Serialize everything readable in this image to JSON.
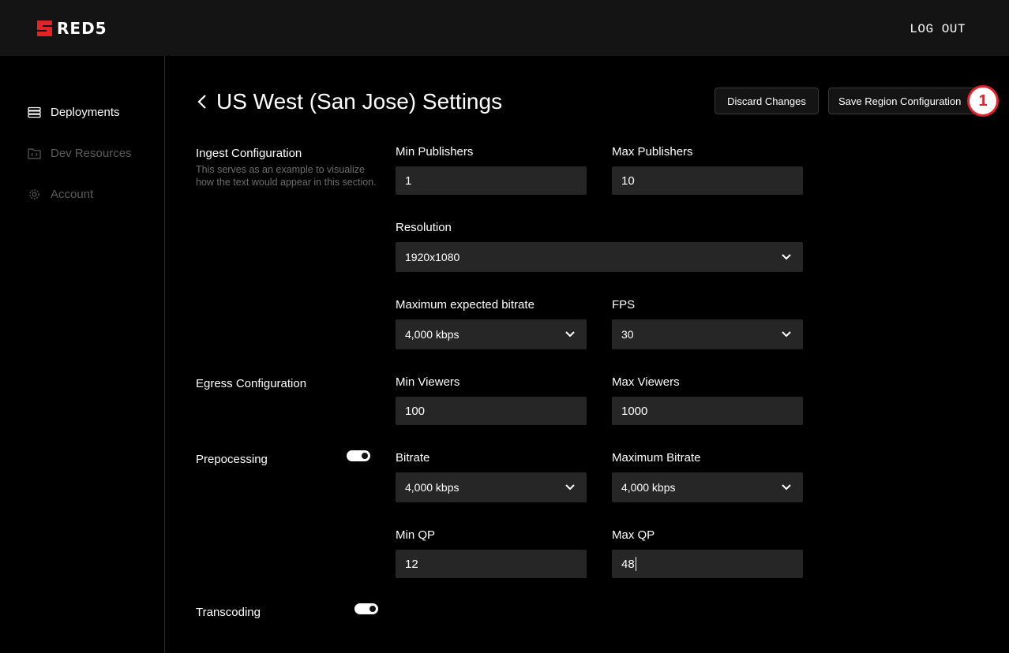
{
  "brand": {
    "name": "RED5",
    "accent": "#e3222a"
  },
  "header": {
    "logout_label": "LOG OUT"
  },
  "sidebar": {
    "items": [
      {
        "label": "Deployments",
        "icon": "database-icon",
        "active": true
      },
      {
        "label": "Dev Resources",
        "icon": "folder-code-icon",
        "active": false
      },
      {
        "label": "Account",
        "icon": "gear-icon",
        "active": false
      }
    ]
  },
  "page": {
    "title": "US West (San Jose) Settings",
    "discard_label": "Discard Changes",
    "save_label": "Save Region Configuration",
    "badge": "1"
  },
  "ingest": {
    "title": "Ingest Configuration",
    "description": "This serves as an example to visualize how the text would appear in this section.",
    "min_publishers_label": "Min Publishers",
    "min_publishers": "1",
    "max_publishers_label": "Max Publishers",
    "max_publishers": "10",
    "resolution_label": "Resolution",
    "resolution": "1920x1080",
    "max_bitrate_label": "Maximum expected bitrate",
    "max_bitrate": "4,000 kbps",
    "fps_label": "FPS",
    "fps": "30"
  },
  "egress": {
    "title": "Egress Configuration",
    "min_viewers_label": "Min Viewers",
    "min_viewers": "100",
    "max_viewers_label": "Max Viewers",
    "max_viewers": "1000"
  },
  "preprocessing": {
    "title": "Prepocessing",
    "enabled": true,
    "bitrate_label": "Bitrate",
    "bitrate": "4,000 kbps",
    "maximum_bitrate_label": "Maximum Bitrate",
    "maximum_bitrate": "4,000 kbps",
    "min_qp_label": "Min QP",
    "min_qp": "12",
    "max_qp_label": "Max QP",
    "max_qp": "48"
  },
  "transcoding": {
    "title": "Transcoding",
    "enabled": true
  }
}
